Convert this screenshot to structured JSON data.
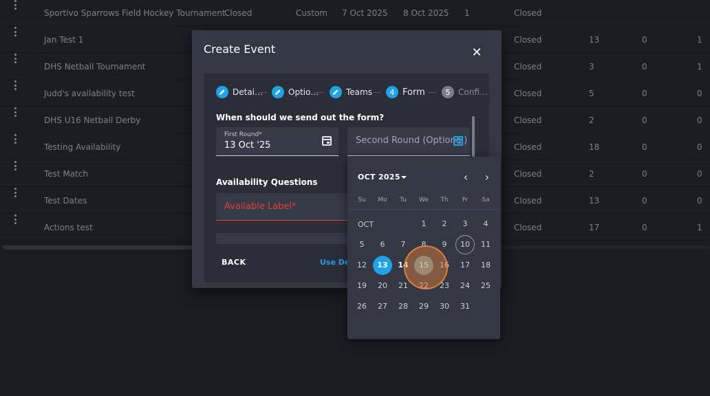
{
  "table": {
    "rows": [
      {
        "name": "Sportivo Sparrows Field Hockey Tournament",
        "status": "Closed",
        "type": "Custom",
        "start": "7 Oct 2025",
        "end": "8 Oct 2025",
        "count": "1",
        "state": "Closed",
        "a": "",
        "b": "",
        "c": ""
      },
      {
        "name": "Jan Test 1",
        "status": "",
        "type": "",
        "start": "",
        "end": "",
        "count": "",
        "state": "Closed",
        "a": "13",
        "b": "0",
        "c": "1"
      },
      {
        "name": "DHS Netball Tournament",
        "status": "",
        "type": "",
        "start": "",
        "end": "",
        "count": "",
        "state": "Closed",
        "a": "3",
        "b": "0",
        "c": "1"
      },
      {
        "name": "Judd's availability test",
        "status": "",
        "type": "",
        "start": "",
        "end": "",
        "count": "",
        "state": "Closed",
        "a": "5",
        "b": "0",
        "c": "0"
      },
      {
        "name": "DHS U16 Netball Derby",
        "status": "",
        "type": "",
        "start": "",
        "end": "",
        "count": "",
        "state": "Closed",
        "a": "2",
        "b": "0",
        "c": "0"
      },
      {
        "name": "Testing Availability",
        "status": "",
        "type": "",
        "start": "",
        "end": "",
        "count": "",
        "state": "Closed",
        "a": "18",
        "b": "0",
        "c": "0"
      },
      {
        "name": "Test Match",
        "status": "",
        "type": "",
        "start": "",
        "end": "",
        "count": "",
        "state": "Closed",
        "a": "2",
        "b": "0",
        "c": "0"
      },
      {
        "name": "Test Dates",
        "status": "",
        "type": "",
        "start": "",
        "end": "",
        "count": "",
        "state": "Closed",
        "a": "13",
        "b": "0",
        "c": "0"
      },
      {
        "name": "Actions test",
        "status": "",
        "type": "",
        "start": "",
        "end": "",
        "count": "",
        "state": "Closed",
        "a": "17",
        "b": "0",
        "c": "1"
      }
    ]
  },
  "modal": {
    "title": "Create Event",
    "close": "✕",
    "steps": [
      {
        "num": "",
        "label": "Detai…",
        "state": "done"
      },
      {
        "num": "",
        "label": "Optio…",
        "state": "done"
      },
      {
        "num": "",
        "label": "Teams",
        "state": "done"
      },
      {
        "num": "4",
        "label": "Form",
        "state": "active"
      },
      {
        "num": "5",
        "label": "Confi…",
        "state": "pending"
      }
    ],
    "question": "When should we send out the form?",
    "first_round_label": "First Round*",
    "first_round_value": "13 Oct '25",
    "second_round_placeholder": "Second Round (Optional)",
    "availability_title": "Availability Questions",
    "available_label_placeholder": "Available Label*",
    "back": "BACK",
    "use_default": "Use De"
  },
  "picker": {
    "month_label": "OCT 2025",
    "prev": "‹",
    "next": "›",
    "dow": [
      "Su",
      "Mo",
      "Tu",
      "We",
      "Th",
      "Fr",
      "Sa"
    ],
    "month_short": "OCT",
    "weeks": [
      [
        "",
        "",
        "",
        "1",
        "2",
        "3",
        "4"
      ],
      [
        "5",
        "6",
        "7",
        "8",
        "9",
        "10",
        "11"
      ],
      [
        "12",
        "13",
        "14",
        "15",
        "16",
        "17",
        "18"
      ],
      [
        "19",
        "20",
        "21",
        "22",
        "23",
        "24",
        "25"
      ],
      [
        "26",
        "27",
        "28",
        "29",
        "30",
        "31",
        ""
      ]
    ],
    "today": "10",
    "selected": "13",
    "hovered": "15",
    "accent": "#1fa2e6",
    "error": "#e0413b"
  }
}
